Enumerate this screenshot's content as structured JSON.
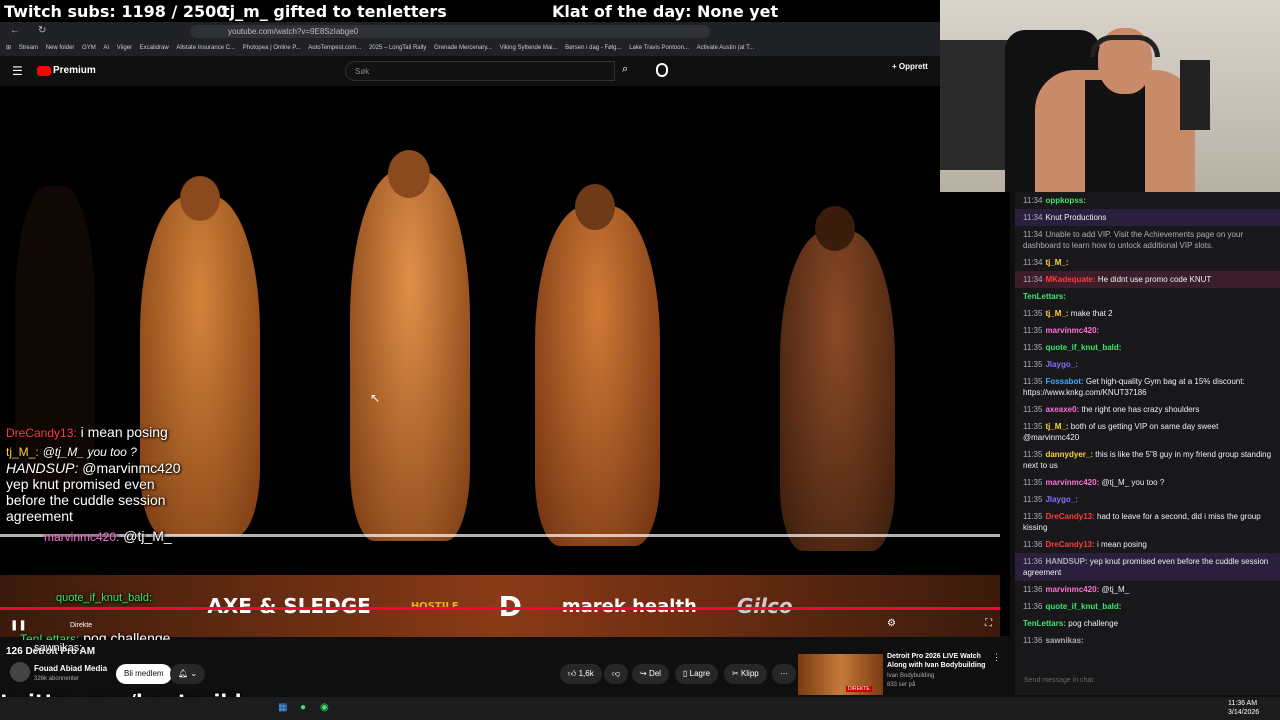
{
  "overlay": {
    "subs": "Twitch subs: 1198 / 2500",
    "gift": "tj_m_ gifted to tenletters",
    "klat": "Klat of the day: None yet",
    "twitter": "twitter.com/knutspild"
  },
  "browser": {
    "url": "youtube.com/watch?v=9E8SzIabge0",
    "bookmarks": [
      "Stream",
      "New folder",
      "GYM",
      "AI",
      "Viiger",
      "Excalidraw",
      "Allstate Insurance C...",
      "Photopea | Online P...",
      "AutoTempest.com...",
      "2025 – LongTail Rally",
      "Grenade Mercenary...",
      "Viking Syttende Mai...",
      "Børsen i dag - Følg...",
      "Lake Travis Pontoon...",
      "Activate Austin (at T..."
    ]
  },
  "youtube": {
    "brand": "Premium",
    "search_placeholder": "Søk",
    "create_label": "Opprett",
    "live_label": "Direkte",
    "video_title": "126 Detroit Pro AM",
    "channel": "Fouad Abiad Media",
    "subscribers": "326k abonnenter",
    "join_label": "Bli medlem",
    "likes": "1,6k",
    "share_label": "Del",
    "save_label": "Lagre",
    "clip_label": "Klipp",
    "recommended": {
      "title": "Detroit Pro 2026 LIVE Watch Along with Ivan Bodybuilding",
      "channel": "Ivan Bodybuilding",
      "views": "833 ser på",
      "badge": "DIREKTE"
    }
  },
  "sponsors": [
    "AXE & SLEDGE",
    "HOSTILE",
    "D",
    "marek health",
    "Gilco"
  ],
  "video_chat": [
    {
      "user": "DreCandy13:",
      "text": "i mean posing",
      "color": "#ff3b3b"
    },
    {
      "user": "tj_M_:",
      "text": "@tj_M_ you too ?",
      "color": "#ffd23f"
    },
    {
      "user": "HANDSUP:",
      "text": "@marvinmc420 yep knut promised even before the cuddle session agreement",
      "color": "#ffffff"
    },
    {
      "user": "marvinmc420:",
      "text": "@tj_M_",
      "color": "#ff6fd8"
    },
    {
      "user": "quote_if_knut_bald:",
      "text": "",
      "color": "#3fe36b"
    },
    {
      "user": "TenLettars:",
      "text": "pog challenge",
      "color": "#3fe36b"
    },
    {
      "user": "sawnikas:",
      "text": "",
      "color": "#ffffff"
    }
  ],
  "chat": {
    "input_placeholder": "Send message in chat",
    "messages": [
      {
        "time": "11:34",
        "user": "oppkopss:",
        "text": "",
        "color": "#3fe36b"
      },
      {
        "time": "11:34",
        "user": "",
        "text": "Knut Productions",
        "color": "#ff3b3b"
      },
      {
        "time": "11:34",
        "user": "",
        "text": "Unable to add VIP. Visit the Achievements page on your dashboard to learn how to unlock additional VIP slots.",
        "color": "#adadb8"
      },
      {
        "time": "11:34",
        "user": "tj_M_:",
        "text": "",
        "color": "#ffd23f"
      },
      {
        "time": "11:34",
        "user": "MKadequate:",
        "text": "He didnt use promo code KNUT",
        "color": "#ff3b3b"
      },
      {
        "time": "",
        "user": "TenLettars:",
        "text": "",
        "color": "#3fe36b"
      },
      {
        "time": "11:35",
        "user": "tj_M_:",
        "text": "make that 2",
        "color": "#ffd23f"
      },
      {
        "time": "11:35",
        "user": "marvinmc420:",
        "text": "",
        "color": "#ff6fd8"
      },
      {
        "time": "11:35",
        "user": "quote_if_knut_bald:",
        "text": "",
        "color": "#3fe36b"
      },
      {
        "time": "11:35",
        "user": "Jlaygo_:",
        "text": "",
        "color": "#8a6cff"
      },
      {
        "time": "11:35",
        "user": "Fossabot:",
        "text": "Get high-quality Gym bag at a 15% discount: https://www.knkg.com/KNUT37186",
        "color": "#3fa9ff"
      },
      {
        "time": "11:35",
        "user": "axeaxe0:",
        "text": "the right one has crazy shoulders",
        "color": "#ff6fd8"
      },
      {
        "time": "11:35",
        "user": "tj_M_:",
        "text": "both of us getting VIP on same day sweet @marvinmc420",
        "color": "#ffd23f"
      },
      {
        "time": "11:35",
        "user": "dannydyer_:",
        "text": "this is like the 5\"8 guy in my friend group standing next to us",
        "color": "#ffd23f"
      },
      {
        "time": "11:35",
        "user": "marvinmc420:",
        "text": "@tj_M_ you too ?",
        "color": "#ff6fd8"
      },
      {
        "time": "11:35",
        "user": "Jlaygo_:",
        "text": "",
        "color": "#8a6cff"
      },
      {
        "time": "11:35",
        "user": "DreCandy13:",
        "text": "had to leave for a second, did i miss the group kissing",
        "color": "#ff3b3b"
      },
      {
        "time": "11:36",
        "user": "DreCandy13:",
        "text": "i mean posing",
        "color": "#ff3b3b"
      },
      {
        "time": "11:36",
        "user": "HANDSUP:",
        "text": "yep knut promised even before the cuddle session agreement",
        "color": "#adadb8"
      },
      {
        "time": "11:36",
        "user": "marvinmc420:",
        "text": "@tj_M_",
        "color": "#ff6fd8"
      },
      {
        "time": "11:36",
        "user": "quote_if_knut_bald:",
        "text": "",
        "color": "#3fe36b"
      },
      {
        "time": "",
        "user": "TenLettars:",
        "text": "pog challenge",
        "color": "#3fe36b"
      },
      {
        "time": "11:36",
        "user": "sawnikas:",
        "text": "",
        "color": "#adadb8"
      }
    ]
  },
  "taskbar": {
    "time": "11:36 AM",
    "date": "3/14/2026"
  }
}
